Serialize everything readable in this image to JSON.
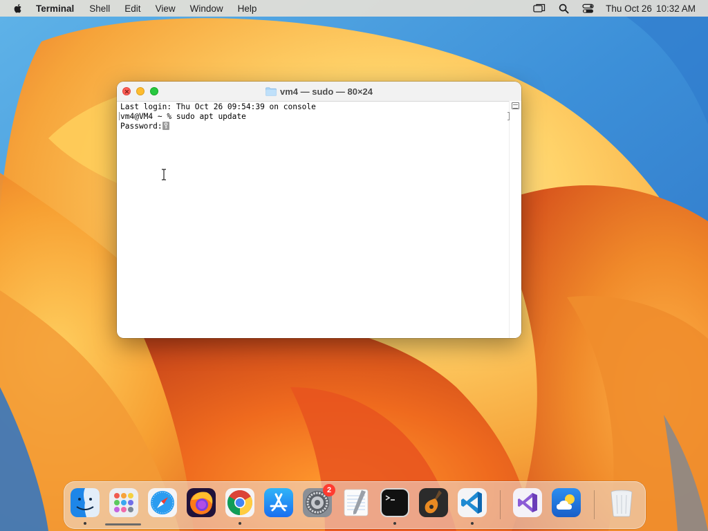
{
  "menubar": {
    "app_name": "Terminal",
    "menus": [
      "Shell",
      "Edit",
      "View",
      "Window",
      "Help"
    ],
    "status_icons": [
      "screen-mirroring-icon",
      "spotlight-search-icon",
      "control-center-icon"
    ],
    "date": "Thu Oct 26",
    "time": "10:32 AM"
  },
  "terminal": {
    "title": "vm4 — sudo — 80×24",
    "lines": [
      "Last login: Thu Oct 26 09:54:39 on console",
      "vm4@VM4 ~ % sudo apt update",
      "Password:"
    ]
  },
  "dock": {
    "apps": [
      {
        "name": "Finder",
        "icon": "finder-icon",
        "running": true
      },
      {
        "name": "Launchpad",
        "icon": "launchpad-icon",
        "running": false
      },
      {
        "name": "Safari",
        "icon": "safari-icon",
        "running": false
      },
      {
        "name": "Firefox",
        "icon": "firefox-icon",
        "running": false
      },
      {
        "name": "Google Chrome",
        "icon": "chrome-icon",
        "running": true
      },
      {
        "name": "App Store",
        "icon": "app-store-icon",
        "running": false
      },
      {
        "name": "System Settings",
        "icon": "system-settings-icon",
        "running": false,
        "badge": "2"
      },
      {
        "name": "TextEdit",
        "icon": "textedit-icon",
        "running": false
      },
      {
        "name": "Terminal",
        "icon": "terminal-icon",
        "running": true
      },
      {
        "name": "GarageBand",
        "icon": "garageband-icon",
        "running": false
      },
      {
        "name": "Visual Studio Code",
        "icon": "vscode-icon",
        "running": true
      },
      {
        "name": "Visual Studio",
        "icon": "visual-studio-icon",
        "running": false
      },
      {
        "name": "Weather",
        "icon": "weather-icon",
        "running": false
      },
      {
        "name": "Trash",
        "icon": "trash-icon",
        "running": false
      }
    ]
  },
  "colors": {
    "close": "#fe5f57",
    "minimize": "#febc2e",
    "zoom": "#28c840",
    "badge": "#ff3b30"
  }
}
